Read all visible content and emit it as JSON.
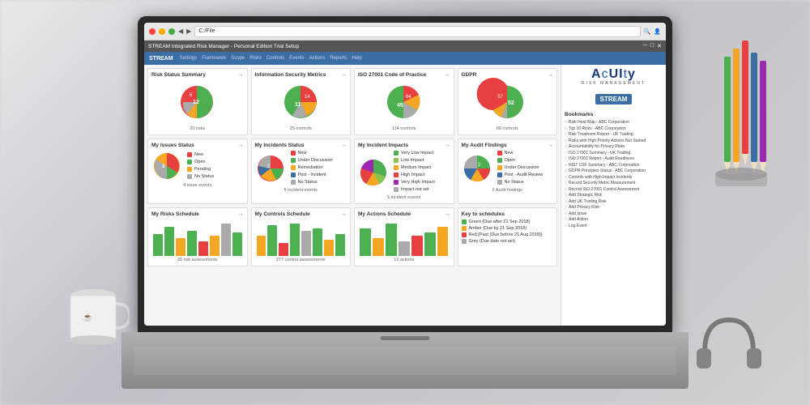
{
  "app": {
    "title": "STREAM Integrated Risk Manager - Personal Edition Trial Setup",
    "url": "C:/File",
    "menu_items": [
      "Settings",
      "Framework",
      "Scope",
      "Risks",
      "Controls",
      "Events",
      "Actions",
      "Reports",
      "Help"
    ]
  },
  "acuity": {
    "name": "ACUITY",
    "subtitle": "RISK MANAGEMENT",
    "stream_label": "STREAM"
  },
  "sections": {
    "risk_status": {
      "title": "Risk Status Summary",
      "subtitle": "20 risks"
    },
    "info_security": {
      "title": "Information Security Metrics",
      "subtitle": "25 controls"
    },
    "iso27001": {
      "title": "ISO 27001 Code of Practice",
      "subtitle": "114 controls"
    },
    "gdpr": {
      "title": "GDPR",
      "subtitle": "80 controls"
    },
    "issues": {
      "title": "My Issues Status",
      "subtitle": "4 issue events"
    },
    "incidents": {
      "title": "My Incidents Status",
      "subtitle": "5 incident events"
    },
    "incident_impacts": {
      "title": "My Incident Impacts",
      "subtitle": "5 incident events"
    },
    "audit_findings": {
      "title": "My Audit Findings",
      "subtitle": "2 Audit findings"
    },
    "risks_schedule": {
      "title": "My Risks Schedule",
      "subtitle": "20 risk assessments"
    },
    "controls_schedule": {
      "title": "My Controls Schedule",
      "subtitle": "277 control assessments"
    },
    "actions_schedule": {
      "title": "My Actions Schedule",
      "subtitle": "13 actions"
    }
  },
  "legend": {
    "issues": [
      "New",
      "Open",
      "Pending",
      "No Status"
    ],
    "incidents": [
      "New",
      "Under Discussion",
      "Remediation",
      "Post - Incident Review",
      "No Status"
    ],
    "impacts": [
      "Very Low Impact",
      "Low Impact",
      "Medium Impact",
      "High Impact",
      "Very High Impact",
      "Impact not set"
    ],
    "audit": [
      "New",
      "Open",
      "Under Discussion",
      "Post - Audit Review",
      "No Status"
    ]
  },
  "schedule_legend": {
    "green": "Green (Due after 21 Sep 2018)",
    "amber": "Amber (Due by 21 Sep 2018)",
    "red": "Red (Past (Due before 21 Aug 2018))",
    "grey": "Grey (Due date not set)"
  },
  "bookmarks": {
    "title": "Bookmarks",
    "items": [
      "Risk Heat Map - ABC Corporation",
      "Top 10 Risks - ABC Corporation",
      "Risk Treatment Report - UK Trading",
      "Risks with High Priority Actions Not Started",
      "Accountability for Privacy Risks",
      "ISO 27001 Summary - UK Trading",
      "ISO 27001 Report - Audit Readiness",
      "NIST CSF Summary - ABC Corporation",
      "GDPR Principles Status - ABC Corporation",
      "Controls with High Impact Incidents",
      "Record Security Metric Measurement",
      "Record ISO 27001 Control Assessment",
      "Add Strategic Risk",
      "Add UK Trading Risk",
      "Add Privacy Risk",
      "Add Issue",
      "Add Action",
      "Log Event"
    ]
  },
  "colors": {
    "red": "#e84040",
    "green": "#4caf50",
    "amber": "#f5a623",
    "blue": "#3a6ea5",
    "grey": "#aaaaaa",
    "yellow": "#f5e042",
    "teal": "#4db6ac",
    "purple": "#9c27b0",
    "pink": "#e91e63",
    "light_green": "#8bc34a"
  }
}
